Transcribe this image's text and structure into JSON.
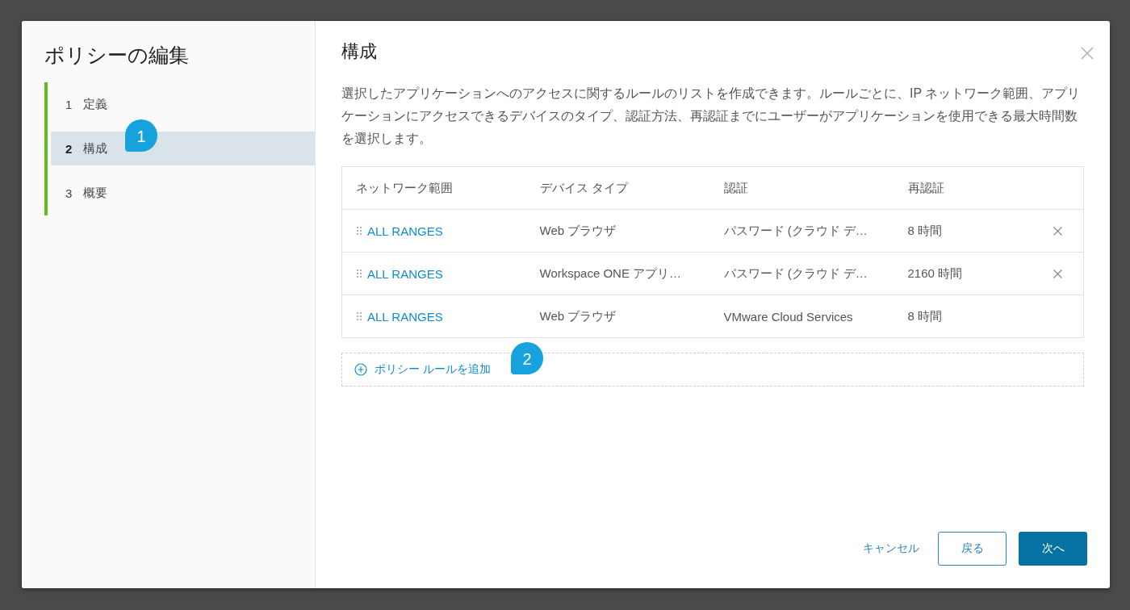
{
  "dialog": {
    "title": "ポリシーの編集",
    "steps": [
      {
        "number": "1",
        "label": "定義",
        "selected": false
      },
      {
        "number": "2",
        "label": "構成",
        "selected": true
      },
      {
        "number": "3",
        "label": "概要",
        "selected": false
      }
    ],
    "panel_title": "構成",
    "description": "選択したアプリケーションへのアクセスに関するルールのリストを作成できます。ルールごとに、IP ネットワーク範囲、アプリケーションにアクセスできるデバイスのタイプ、認証方法、再認証までにユーザーがアプリケーションを使用できる最大時間数を選択します。",
    "table": {
      "columns": [
        "ネットワーク範囲",
        "デバイス タイプ",
        "認証",
        "再認証"
      ],
      "rows": [
        {
          "network_range": "ALL RANGES",
          "device_type": "Web ブラウザ",
          "authentication": "パスワード (クラウド デ…",
          "reauthentication": "8 時間",
          "removable": true
        },
        {
          "network_range": "ALL RANGES",
          "device_type": "Workspace ONE アプリ…",
          "authentication": "パスワード (クラウド デ…",
          "reauthentication": "2160 時間",
          "removable": true
        },
        {
          "network_range": "ALL RANGES",
          "device_type": "Web ブラウザ",
          "authentication": "VMware Cloud Services",
          "reauthentication": "8 時間",
          "removable": false
        }
      ]
    },
    "add_rule": "ポリシー ルールを追加",
    "buttons": {
      "cancel": "キャンセル",
      "back": "戻る",
      "next": "次へ"
    }
  },
  "callouts": [
    {
      "label": "1"
    },
    {
      "label": "2"
    }
  ]
}
